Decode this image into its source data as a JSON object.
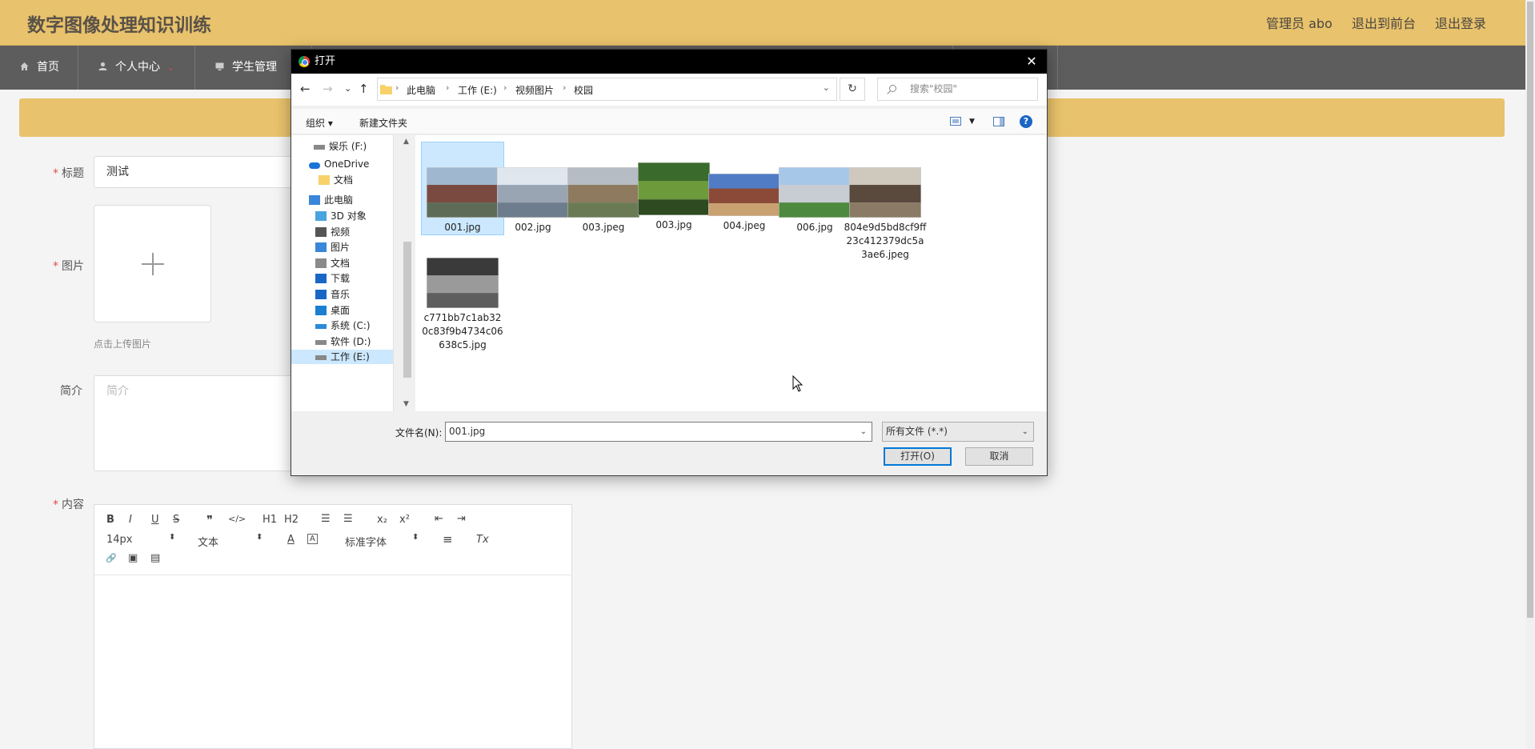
{
  "site": {
    "title": "数字图像处理知识训练",
    "user_label": "管理员 abo",
    "back_front": "退出到前台",
    "logout": "退出登录"
  },
  "nav": {
    "home": "首页",
    "profile": "个人中心",
    "profile_caret": "⌄",
    "students": "学生管理"
  },
  "form": {
    "title_label": "标题",
    "title_value": "测试",
    "image_label": "图片",
    "upload_hint": "点击上传图片",
    "intro_label": "简介",
    "intro_placeholder": "简介",
    "content_label": "内容",
    "required_mark": "*"
  },
  "editor": {
    "bold": "B",
    "italic": "I",
    "underline": "U",
    "strike": "S",
    "quote": "❞",
    "code": "</>",
    "h1": "H1",
    "h2": "H2",
    "ol": "☰",
    "ul": "☰",
    "sub": "x₂",
    "sup": "x²",
    "outdent": "⇤",
    "indent": "⇥",
    "font_size": "14px",
    "text_style": "文本",
    "color": "A",
    "bg": "A",
    "font_family": "标准字体",
    "align": "≡",
    "clear": "Tx",
    "link": "🔗",
    "image": "▣",
    "video": "▤"
  },
  "dialog": {
    "title": "打开",
    "close": "✕",
    "back": "←",
    "forward": "→",
    "recent": "⌄",
    "up": "↑",
    "refresh": "↻",
    "search_placeholder": "搜索\"校园\"",
    "breadcrumb": [
      "此电脑",
      "工作 (E:)",
      "视频图片",
      "校园"
    ],
    "organize": "组织 ▾",
    "new_folder": "新建文件夹",
    "help": "?",
    "tree": [
      {
        "label": "娱乐 (F:)",
        "icon": "drive-icon"
      },
      {
        "label": "OneDrive",
        "icon": "cloud-icon"
      },
      {
        "label": "文档",
        "icon": "folder-icon"
      },
      {
        "label": "此电脑",
        "icon": "computer-icon"
      },
      {
        "label": "3D 对象",
        "icon": "cube-icon"
      },
      {
        "label": "视频",
        "icon": "video-icon"
      },
      {
        "label": "图片",
        "icon": "pictures-icon"
      },
      {
        "label": "文档",
        "icon": "documents-icon"
      },
      {
        "label": "下载",
        "icon": "download-icon"
      },
      {
        "label": "音乐",
        "icon": "music-icon"
      },
      {
        "label": "桌面",
        "icon": "desktop-icon"
      },
      {
        "label": "系统 (C:)",
        "icon": "windows-drive-icon"
      },
      {
        "label": "软件 (D:)",
        "icon": "drive-icon"
      },
      {
        "label": "工作 (E:)",
        "icon": "drive-icon"
      }
    ],
    "files": [
      {
        "name": "001.jpg",
        "colors": [
          "#9fb8cf",
          "#7a4a40",
          "#5d6b57"
        ]
      },
      {
        "name": "002.jpg",
        "colors": [
          "#dfe6ee",
          "#9aa5b4",
          "#6e7d8e"
        ]
      },
      {
        "name": "003.jpeg",
        "colors": [
          "#b5bcc4",
          "#8d7a5f",
          "#6a7a55"
        ]
      },
      {
        "name": "003.jpg",
        "colors": [
          "#3b6b2c",
          "#6d9a3a",
          "#2d4a20"
        ]
      },
      {
        "name": "004.jpeg",
        "colors": [
          "#4f7cc4",
          "#8b4a38",
          "#c9a070"
        ]
      },
      {
        "name": "006.jpg",
        "colors": [
          "#a7c7e8",
          "#c7cdd2",
          "#4d8a3f"
        ]
      },
      {
        "name": "804e9d5bd8cf9ff23c412379dc5a3ae6.jpeg",
        "colors": [
          "#cfc8bd",
          "#5a4a3e",
          "#8a7a66"
        ]
      },
      {
        "name": "c771bb7c1ab320c83f9b4734c06638c5.jpg",
        "colors": [
          "#3a3a3a",
          "#9a9a9a",
          "#5e5e5e"
        ]
      }
    ],
    "filename_label": "文件名(N):",
    "filename_value": "001.jpg",
    "filetype": "所有文件 (*.*)",
    "open": "打开(O)",
    "cancel": "取消"
  }
}
